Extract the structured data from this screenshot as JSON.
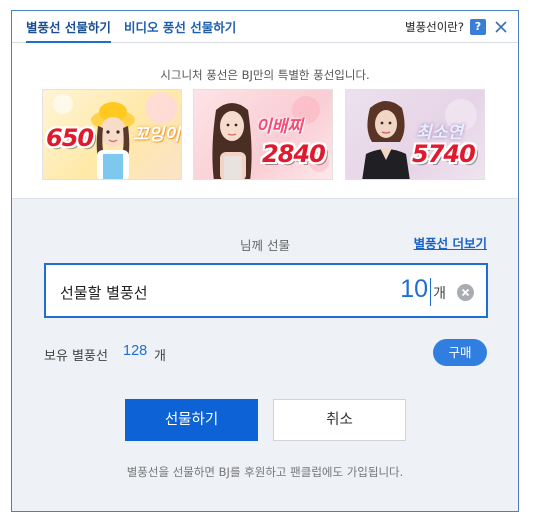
{
  "tabs": [
    {
      "label": "별풍선 선물하기",
      "active": true
    },
    {
      "label": "비디오 풍선 선물하기",
      "active": false
    }
  ],
  "help": {
    "text": "별풍선이란?",
    "icon_glyph": "?",
    "icon": "question-icon"
  },
  "close": {
    "icon": "close-icon"
  },
  "signature": {
    "note": "시그니처 풍선은 BJ만의 특별한 풍선입니다.",
    "items": [
      {
        "amount": "650",
        "script": "꼬잉이",
        "bg": "#ffe9a8"
      },
      {
        "amount": "2840",
        "script": "이배찌",
        "bg": "#f9cdd4"
      },
      {
        "amount": "5740",
        "script": "최소연",
        "bg": "#e6d4e6"
      }
    ]
  },
  "gift": {
    "to_label": "님께 선물",
    "more_link": "별풍선 더보기",
    "input_label": "선물할 별풍선",
    "amount": "10",
    "unit": "개",
    "owned_label": "보유 별풍선",
    "owned_count": "128",
    "owned_unit": "개",
    "buy_label": "구매",
    "submit_label": "선물하기",
    "cancel_label": "취소",
    "footer": "별풍선을 선물하면 BJ를 후원하고 팬클럽에도 가입됩니다."
  },
  "colors": {
    "accent": "#1f6fd1",
    "primary_button": "#0d63d6",
    "signature_red": "#e0192e",
    "panel_bg": "#eef1f6"
  }
}
